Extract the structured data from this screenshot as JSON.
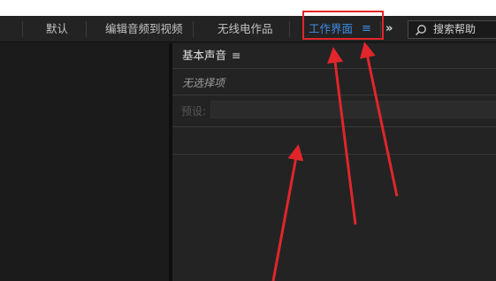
{
  "tabs": [
    {
      "label": "默认",
      "active": false
    },
    {
      "label": "编辑音频到视频",
      "active": false
    },
    {
      "label": "无线电作品",
      "active": false
    },
    {
      "label": "工作界面",
      "active": true
    }
  ],
  "menu_icon": "hamburger-icon",
  "overflow_label": "»",
  "search": {
    "label": "搜索帮助",
    "icon": "search-icon"
  },
  "panel": {
    "title": "基本声音",
    "menu_label": "≡",
    "no_selection": "无选择项",
    "preset_label": "预设:"
  },
  "colors": {
    "accent": "#3e8ee6",
    "highlight_box": "#e0262b",
    "arrow": "#e0262b",
    "background": "#232323"
  }
}
